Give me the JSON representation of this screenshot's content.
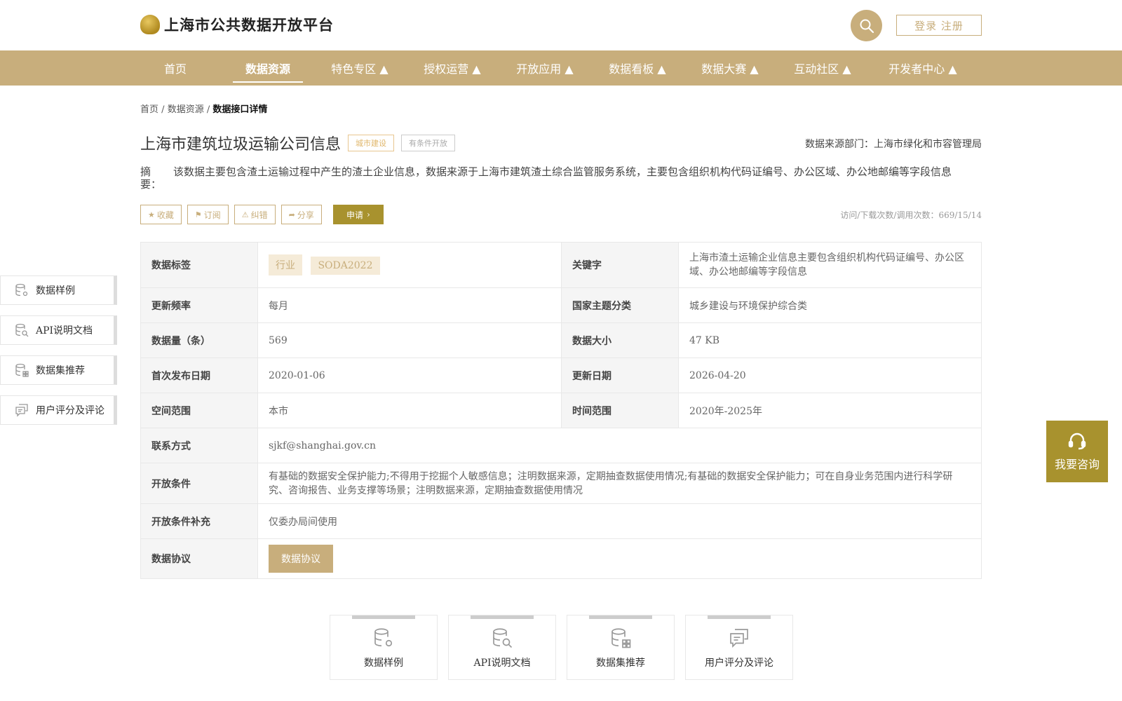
{
  "header": {
    "site_title": "上海市公共数据开放平台",
    "login_label": "登录 注册"
  },
  "nav": {
    "items": [
      {
        "label": "首页"
      },
      {
        "label": "数据资源"
      },
      {
        "label": "特色专区 ▲"
      },
      {
        "label": "授权运营 ▲"
      },
      {
        "label": "开放应用 ▲"
      },
      {
        "label": "数据看板 ▲"
      },
      {
        "label": "数据大赛 ▲"
      },
      {
        "label": "互动社区 ▲"
      },
      {
        "label": "开发者中心 ▲"
      }
    ],
    "active": "数据资源"
  },
  "breadcrumb": {
    "home": "首页",
    "sep": "/",
    "resources": "数据资源",
    "current": "数据接口详情"
  },
  "detail": {
    "title": "上海市建筑垃圾运输公司信息",
    "tag_category": "城市建设",
    "tag_open": "有条件开放",
    "source": "数据来源部门：上海市绿化和市容管理局",
    "abstract_label": "摘 要：",
    "abstract": "该数据主要包含渣土运输过程中产生的渣土企业信息，数据来源于上海市建筑渣土综合监管服务系统，主要包含组织机构代码证编号、办公区域、办公地邮编等字段信息"
  },
  "actions": {
    "favorite": "收藏",
    "subscribe": "订阅",
    "correct": "纠错",
    "share": "分享",
    "apply": "申请",
    "stats": "访问/下载次数/调用次数：669/15/14"
  },
  "table": {
    "tags_label": "数据标签",
    "tags": [
      "行业",
      "SODA2022"
    ],
    "keyword_label": "关键字",
    "keyword": "上海市渣土运输企业信息主要包含组织机构代码证编号、办公区域、办公地邮编等字段信息",
    "freq_label": "更新频率",
    "freq": "每月",
    "theme_label": "国家主题分类",
    "theme": "城乡建设与环境保护综合类",
    "count_label": "数据量（条）",
    "count": "569",
    "size_label": "数据大小",
    "size": "47 KB",
    "first_date_label": "首次发布日期",
    "first_date": "2020-01-06",
    "update_date_label": "更新日期",
    "update_date": "2026-04-20",
    "space_label": "空间范围",
    "space": "本市",
    "time_label": "时间范围",
    "time": "2020年-2025年",
    "contact_label": "联系方式",
    "contact": "sjkf@shanghai.gov.cn",
    "cond_label": "开放条件",
    "cond": "有基础的数据安全保护能力;不得用于挖掘个人敏感信息；注明数据来源，定期抽查数据使用情况;有基础的数据安全保护能力；可在自身业务范围内进行科学研究、咨询报告、业务支撑等场景；注明数据来源，定期抽查数据使用情况",
    "cond_extra_label": "开放条件补充",
    "cond_extra": "仅委办局间使用",
    "agreement_label": "数据协议",
    "agreement_btn": "数据协议"
  },
  "side_nav": {
    "sample": "数据样例",
    "api": "API说明文档",
    "recommend": "数据集推荐",
    "review": "用户评分及评论"
  },
  "consult": {
    "label": "我要咨询"
  },
  "cards": {
    "sample": "数据样例",
    "api": "API说明文档",
    "recommend": "数据集推荐",
    "review": "用户评分及评论"
  },
  "colors": {
    "brand": "#c8ae7c",
    "accent": "#a8922e"
  }
}
